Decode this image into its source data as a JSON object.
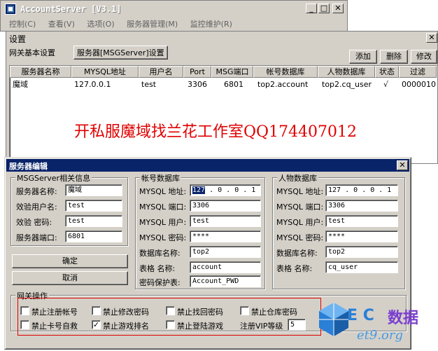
{
  "app": {
    "title": "AccountServer [V3.1]",
    "menu": [
      "控制(C)",
      "查看(V)",
      "选项(O)",
      "服务器管理(M)",
      "监控维护(R)"
    ]
  },
  "settings": {
    "title": "设置",
    "tabs": [
      "网关基本设置",
      "服务器[MSGServer]设置"
    ],
    "buttons": {
      "add": "添加",
      "delete": "删除",
      "modify": "修改"
    },
    "columns": [
      "服务器名称",
      "MYSQL地址",
      "用户名",
      "Port",
      "MSG端口",
      "帐号数据库",
      "人物数据库",
      "状态",
      "过滤"
    ],
    "rows": [
      [
        "魔域",
        "127.0.0.1",
        "test",
        "3306",
        "6801",
        "top2.account",
        "top2.cq_user",
        "√",
        "0000010"
      ]
    ]
  },
  "watermark": "开私服魔域找兰花工作室QQ174407012",
  "dialog": {
    "title": "服务器编辑",
    "msg_group": {
      "title": "MSGServer相关信息",
      "name_label": "服务器名称:",
      "name_value": "魔域",
      "user_label": "效验用户名:",
      "user_value": "test",
      "pwd_label": "效验  密码:",
      "pwd_value": "test",
      "port_label": "服务器端口:",
      "port_value": "6801"
    },
    "ok_label": "确定",
    "cancel_label": "取消",
    "account_db": {
      "title": "帐号数据库",
      "addr_label": "MYSQL 地址:",
      "addr_sel": "127",
      "addr_rest": " . 0 . 0 . 1",
      "port_label": "MYSQL 端口:",
      "port_value": "3306",
      "user_label": "MYSQL 用户:",
      "user_value": "test",
      "pwd_label": "MYSQL 密码:",
      "pwd_value": "****",
      "db_label": "数据库名称:",
      "db_value": "top2",
      "table_label": "表格  名称:",
      "table_value": "account",
      "protect_label": "密码保护表:",
      "protect_value": "Account_PWD"
    },
    "player_db": {
      "title": "人物数据库",
      "addr_label": "MYSQL 地址:",
      "addr_value": "127 . 0 . 0 . 1",
      "port_label": "MYSQL 端口:",
      "port_value": "3306",
      "user_label": "MYSQL 用户:",
      "user_value": "test",
      "pwd_label": "MYSQL 密码:",
      "pwd_value": "****",
      "db_label": "数据库名称:",
      "db_value": "top2",
      "table_label": "表格  名称:",
      "table_value": "cq_user"
    },
    "gateway": {
      "title": "网关操作",
      "options": [
        {
          "label": "禁止注册帐号",
          "checked": false
        },
        {
          "label": "禁止修改密码",
          "checked": false
        },
        {
          "label": "禁止找回密码",
          "checked": false
        },
        {
          "label": "禁止仓库密码",
          "checked": false
        },
        {
          "label": "禁止卡号自救",
          "checked": false
        },
        {
          "label": "禁止游戏排名",
          "checked": true
        },
        {
          "label": "禁止登陆游戏",
          "checked": false
        }
      ],
      "vip_label": "注册VIP等级",
      "vip_value": "5"
    }
  },
  "logo": {
    "text": "数据",
    "site": "et9.org",
    "letters": "E C"
  },
  "colors": {
    "title_blue": "#0a246a",
    "watermark_red": "#e00000",
    "logo_purple": "#7a3ecf"
  }
}
